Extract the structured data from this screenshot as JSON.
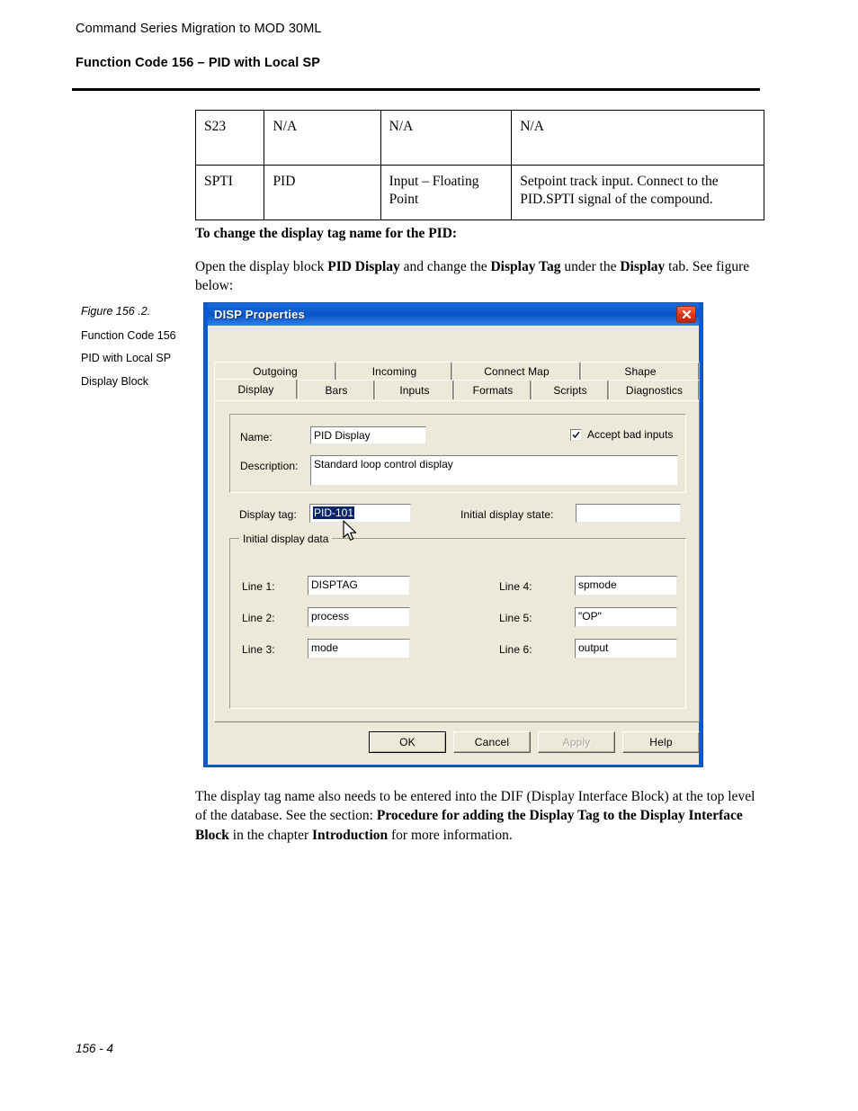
{
  "page": {
    "header_title": "Command Series Migration to MOD 30ML",
    "header_subtitle": "Function Code 156 – PID with Local SP",
    "footer": "156 - 4"
  },
  "spec_table": {
    "rows": [
      {
        "cells": [
          "S23",
          "N/A",
          "N/A",
          "N/A"
        ]
      },
      {
        "cells": [
          "SPTI",
          "PID",
          "Input – Floating Point",
          "Setpoint track input. Connect to the PID.SPTI signal of the compound."
        ]
      }
    ]
  },
  "body": {
    "heading": "To change the display tag name for the PID:",
    "intro_parts": [
      {
        "text": "Open the display block ",
        "bold": false
      },
      {
        "text": "PID Display",
        "bold": true
      },
      {
        "text": " and change the ",
        "bold": false
      },
      {
        "text": "Display Tag",
        "bold": true
      },
      {
        "text": " under the ",
        "bold": false
      },
      {
        "text": "Display",
        "bold": true
      },
      {
        "text": " tab. See figure below:",
        "bold": false
      }
    ],
    "outro_parts": [
      {
        "text": "The display tag name also needs to be entered into the DIF (Display Interface Block) at the top level of the database. See the section: ",
        "bold": false
      },
      {
        "text": "Procedure for adding the Display Tag to the Display Interface Block",
        "bold": true
      },
      {
        "text": " in the chapter ",
        "bold": false
      },
      {
        "text": "Introduction",
        "bold": true
      },
      {
        "text": " for more information.",
        "bold": false
      }
    ]
  },
  "figure_caption": {
    "title": "Figure 156 .2.",
    "lines": [
      "Function Code 156",
      "PID with Local SP",
      "Display Block"
    ]
  },
  "dialog": {
    "title": "DISP Properties",
    "close_label": "Close",
    "tabs_row1": [
      "Outgoing",
      "Incoming",
      "Connect Map",
      "Shape"
    ],
    "tabs_row2": [
      "Display",
      "Bars",
      "Inputs",
      "Formats",
      "Scripts",
      "Diagnostics"
    ],
    "selected_tab": "Display",
    "fields": {
      "name_label": "Name:",
      "name_value": "PID Display",
      "description_label": "Description:",
      "description_value": "Standard loop control display",
      "accept_bad_inputs_label": "Accept bad inputs",
      "accept_bad_inputs_checked": true,
      "display_tag_label": "Display tag:",
      "display_tag_value": "PID-101",
      "display_tag_selected": true,
      "initial_display_state_label": "Initial display state:",
      "initial_display_state_value": ""
    },
    "initial_display_data": {
      "legend": "Initial display data",
      "left": [
        {
          "label": "Line 1:",
          "value": "DISPTAG"
        },
        {
          "label": "Line 2:",
          "value": "process"
        },
        {
          "label": "Line 3:",
          "value": "mode"
        }
      ],
      "right": [
        {
          "label": "Line 4:",
          "value": "spmode"
        },
        {
          "label": "Line 5:",
          "value": "\"OP\""
        },
        {
          "label": "Line 6:",
          "value": "output"
        }
      ]
    },
    "buttons": [
      {
        "label": "OK",
        "state": "default"
      },
      {
        "label": "Cancel",
        "state": "normal"
      },
      {
        "label": "Apply",
        "state": "disabled"
      },
      {
        "label": "Help",
        "state": "normal"
      }
    ],
    "colors": {
      "titlebar_blue": "#0a57c9",
      "face": "#ece9d8",
      "selection_blue": "#0a246a",
      "close_red": "#d8351a"
    }
  }
}
